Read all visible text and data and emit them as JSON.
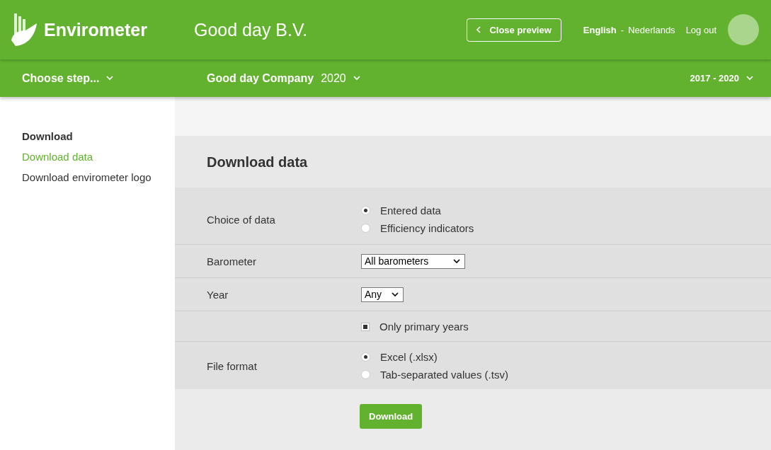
{
  "header": {
    "logo_text": "Envirometer",
    "company": "Good day B.V.",
    "close_preview": "Close preview",
    "languages": [
      {
        "label": "English",
        "selected": true
      },
      {
        "label": "Nederlands",
        "selected": false
      }
    ],
    "separator": "-",
    "logout": "Log out"
  },
  "subbar": {
    "step_menu": "Choose step...",
    "company_name": "Good day Company",
    "year": "2020",
    "period": "2017 - 2020"
  },
  "sidebar": {
    "items": [
      {
        "label": "Download",
        "kind": "heading",
        "selected": false
      },
      {
        "label": "Download data",
        "kind": "link",
        "selected": true
      },
      {
        "label": "Download envirometer logo",
        "kind": "link",
        "selected": false
      }
    ]
  },
  "form": {
    "title": "Download data",
    "rows": [
      {
        "kind": "radio",
        "label": "Choice of data",
        "options": [
          {
            "label": "Entered data",
            "selected": true
          },
          {
            "label": "Efficiency indicators",
            "selected": false
          }
        ]
      },
      {
        "kind": "select",
        "label": "Barometer",
        "value": "All barometers"
      },
      {
        "kind": "select",
        "label": "Year",
        "value": "Any"
      },
      {
        "kind": "checkbox",
        "option": "Only primary years",
        "checked": true
      },
      {
        "kind": "radio",
        "label": "File format",
        "options": [
          {
            "label": "Excel (.xlsx)",
            "selected": true
          },
          {
            "label": "Tab-separated values (.tsv)",
            "selected": false
          }
        ]
      }
    ],
    "button": "Download"
  }
}
